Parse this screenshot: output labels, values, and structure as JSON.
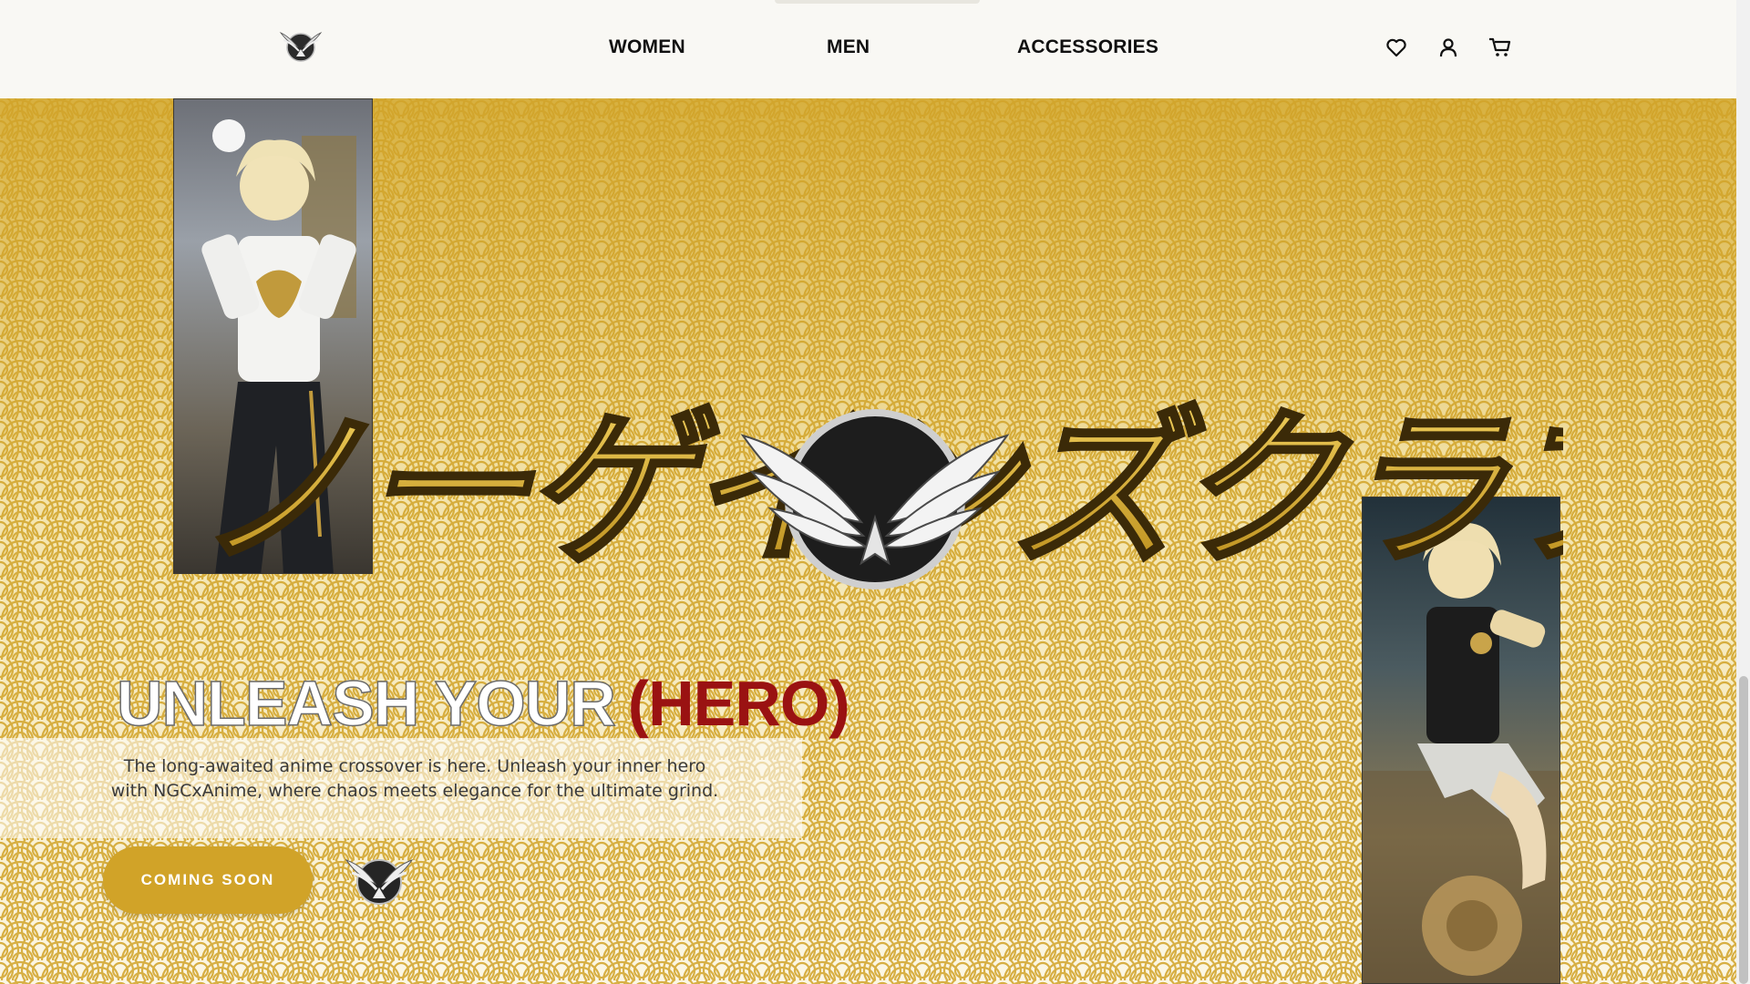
{
  "nav": {
    "links": [
      "WOMEN",
      "MEN",
      "ACCESSORIES"
    ],
    "icons": [
      "heart-icon",
      "user-icon",
      "cart-icon"
    ]
  },
  "hero": {
    "japanese_title": "ノーゲインズクラブ",
    "headline_white": "UNLEASH YOUR",
    "headline_red": "(HERO)",
    "description_line1": "The long-awaited anime crossover is here. Unleash your inner hero",
    "description_line2": "with NGCxAnime, where chaos meets elegance for the ultimate grind.",
    "cta_label": "COMING SOON"
  },
  "colors": {
    "gold": "#d1a328",
    "red": "#9a1212",
    "nav_bg": "#f9f8f4"
  }
}
